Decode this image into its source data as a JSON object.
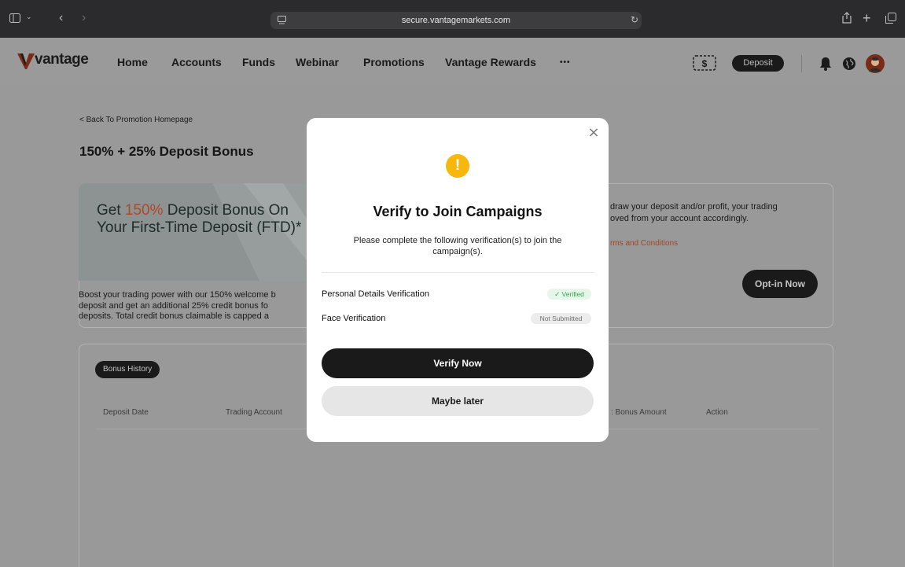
{
  "browser": {
    "url": "secure.vantagemarkets.com",
    "icons": [
      "sidebar-icon",
      "chevron-down-icon",
      "back-icon",
      "forward-icon",
      "page-icon",
      "reload-icon",
      "share-icon",
      "new-tab-icon",
      "tabs-icon"
    ]
  },
  "nav": {
    "brand": "vantage",
    "items": [
      "Home",
      "Accounts",
      "Funds",
      "Webinar",
      "Promotions",
      "Vantage Rewards",
      "•••"
    ],
    "deposit_label": "Deposit",
    "icons": [
      "wallet-icon",
      "bell-icon",
      "globe-icon",
      "avatar"
    ]
  },
  "page": {
    "back_link": "< Back To Promotion Homepage",
    "title": "150% + 25% Deposit Bonus",
    "promo": {
      "headline_pre": "Get ",
      "headline_highlight": "150%",
      "headline_post": " Deposit Bonus On Your First-Time Deposit (FTD)*",
      "description_lines": [
        "Boost your trading power with our 150% welcome b",
        "deposit and get an additional 25% credit bonus fo",
        "deposits. Total credit bonus claimable is capped a"
      ],
      "right_lines": [
        "draw your deposit and/or profit, your trading",
        "oved from your account accordingly."
      ],
      "terms_link": "rms and Conditions",
      "optin_label": "Opt-in Now"
    },
    "history": {
      "badge": "Bonus History",
      "columns": [
        "Deposit Date",
        "Trading Account",
        ": Bonus Amount",
        "Action"
      ]
    }
  },
  "modal": {
    "title": "Verify to Join Campaigns",
    "description": "Please complete the following verification(s) to join the campaign(s).",
    "rows": [
      {
        "label": "Personal Details Verification",
        "status": "✓ Verified"
      },
      {
        "label": "Face Verification",
        "status": "Not Submitted"
      }
    ],
    "primary_button": "Verify Now",
    "secondary_button": "Maybe later",
    "colors": {
      "warning": "#f6b80d",
      "verified": "#33a54f",
      "primary": "#1a1a1a"
    }
  }
}
